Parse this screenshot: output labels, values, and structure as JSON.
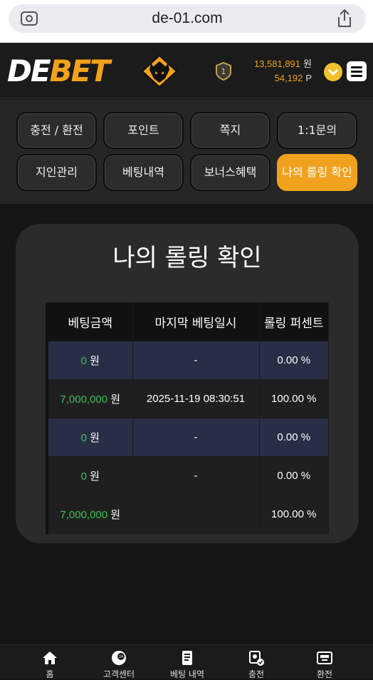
{
  "browser": {
    "url": "de-01.com"
  },
  "header": {
    "logo_de": "DE",
    "logo_bet": "BET",
    "rank_level": "1",
    "balance": "13,581,891",
    "balance_unit": "원",
    "points": "54,192",
    "points_unit": "P"
  },
  "tabs": [
    {
      "label": "충전 / 환전"
    },
    {
      "label": "포인트"
    },
    {
      "label": "쪽지"
    },
    {
      "label": "1:1문의"
    },
    {
      "label": "지인관리"
    },
    {
      "label": "베팅내역"
    },
    {
      "label": "보너스혜택"
    },
    {
      "label": "나의 롤링 확인"
    }
  ],
  "page": {
    "title": "나의 롤링 확인",
    "columns": [
      "베팅금액",
      "마지막 베팅일시",
      "롤링 퍼센트"
    ],
    "rows": [
      {
        "amount": "0",
        "unit": "원",
        "date": "-",
        "percent": "0.00 %"
      },
      {
        "amount": "7,000,000",
        "unit": "원",
        "date": "2025-11-19 08:30:51",
        "percent": "100.00 %"
      },
      {
        "amount": "0",
        "unit": "원",
        "date": "-",
        "percent": "0.00 %"
      },
      {
        "amount": "0",
        "unit": "원",
        "date": "-",
        "percent": "0.00 %"
      },
      {
        "amount": "7,000,000",
        "unit": "원",
        "date": "",
        "percent": "100.00 %"
      }
    ]
  },
  "bottom_nav": [
    {
      "label": "홈",
      "icon": "home-icon"
    },
    {
      "label": "고객센터",
      "icon": "support-icon"
    },
    {
      "label": "베팅 내역",
      "icon": "betting-history-icon"
    },
    {
      "label": "충전",
      "icon": "deposit-icon"
    },
    {
      "label": "환전",
      "icon": "withdraw-icon"
    }
  ],
  "colors": {
    "accent": "#f0a21e",
    "amount_green": "#3fbf57",
    "row_blue": "#272e45"
  }
}
